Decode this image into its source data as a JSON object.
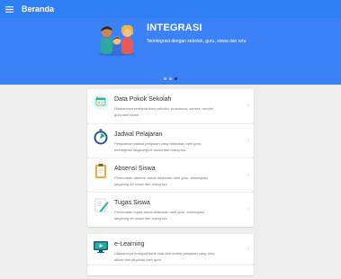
{
  "appbar": {
    "title": "Beranda",
    "menu_icon": "hamburger-menu-icon"
  },
  "hero": {
    "title": "INTEGRASI",
    "subtitle": "Terintegrasi dengan sekolah, guru, siswa dan ortu",
    "slides": 3,
    "active_slide": 3,
    "colors": {
      "background": "#3b82f6",
      "appbar": "#2f7ff5"
    }
  },
  "menu": [
    {
      "icon": "school-data-icon",
      "title": "Data Pokok Sekolah",
      "desc_lines": [
        "Didalamnya terdapat data sekolah, prasarana, sarana, rombel,",
        "guru dan siswa"
      ]
    },
    {
      "icon": "timer-icon",
      "title": "Jadwal Pelajaran",
      "desc_lines": [
        "Pengaturan jadwal pelajaran yang dilakukan oleh guru,",
        "terintegrasi langsung ke siswa dan orang tua."
      ]
    },
    {
      "icon": "clipboard-icon",
      "title": "Absensi Siswa",
      "desc_lines": [
        "Pembuatan absensi siswa dilakukan oleh guru, terintegrasi",
        "langsung ke siswa dan orang tua."
      ]
    },
    {
      "icon": "pencil-icon",
      "title": "Tugas Siswa",
      "desc_lines": [
        "Pembuatan tugas siswa dilakukan oleh guru, terintegrasi",
        "langsung ke siswa dan orang tua."
      ]
    },
    {
      "icon": "elearning-monitor-icon",
      "title": "e-Learning",
      "desc_lines": [
        "Didalamnya terdapat bank soal dan materi pelajaran yang bisa",
        "diikuti dan diupload oleh guru."
      ]
    }
  ]
}
